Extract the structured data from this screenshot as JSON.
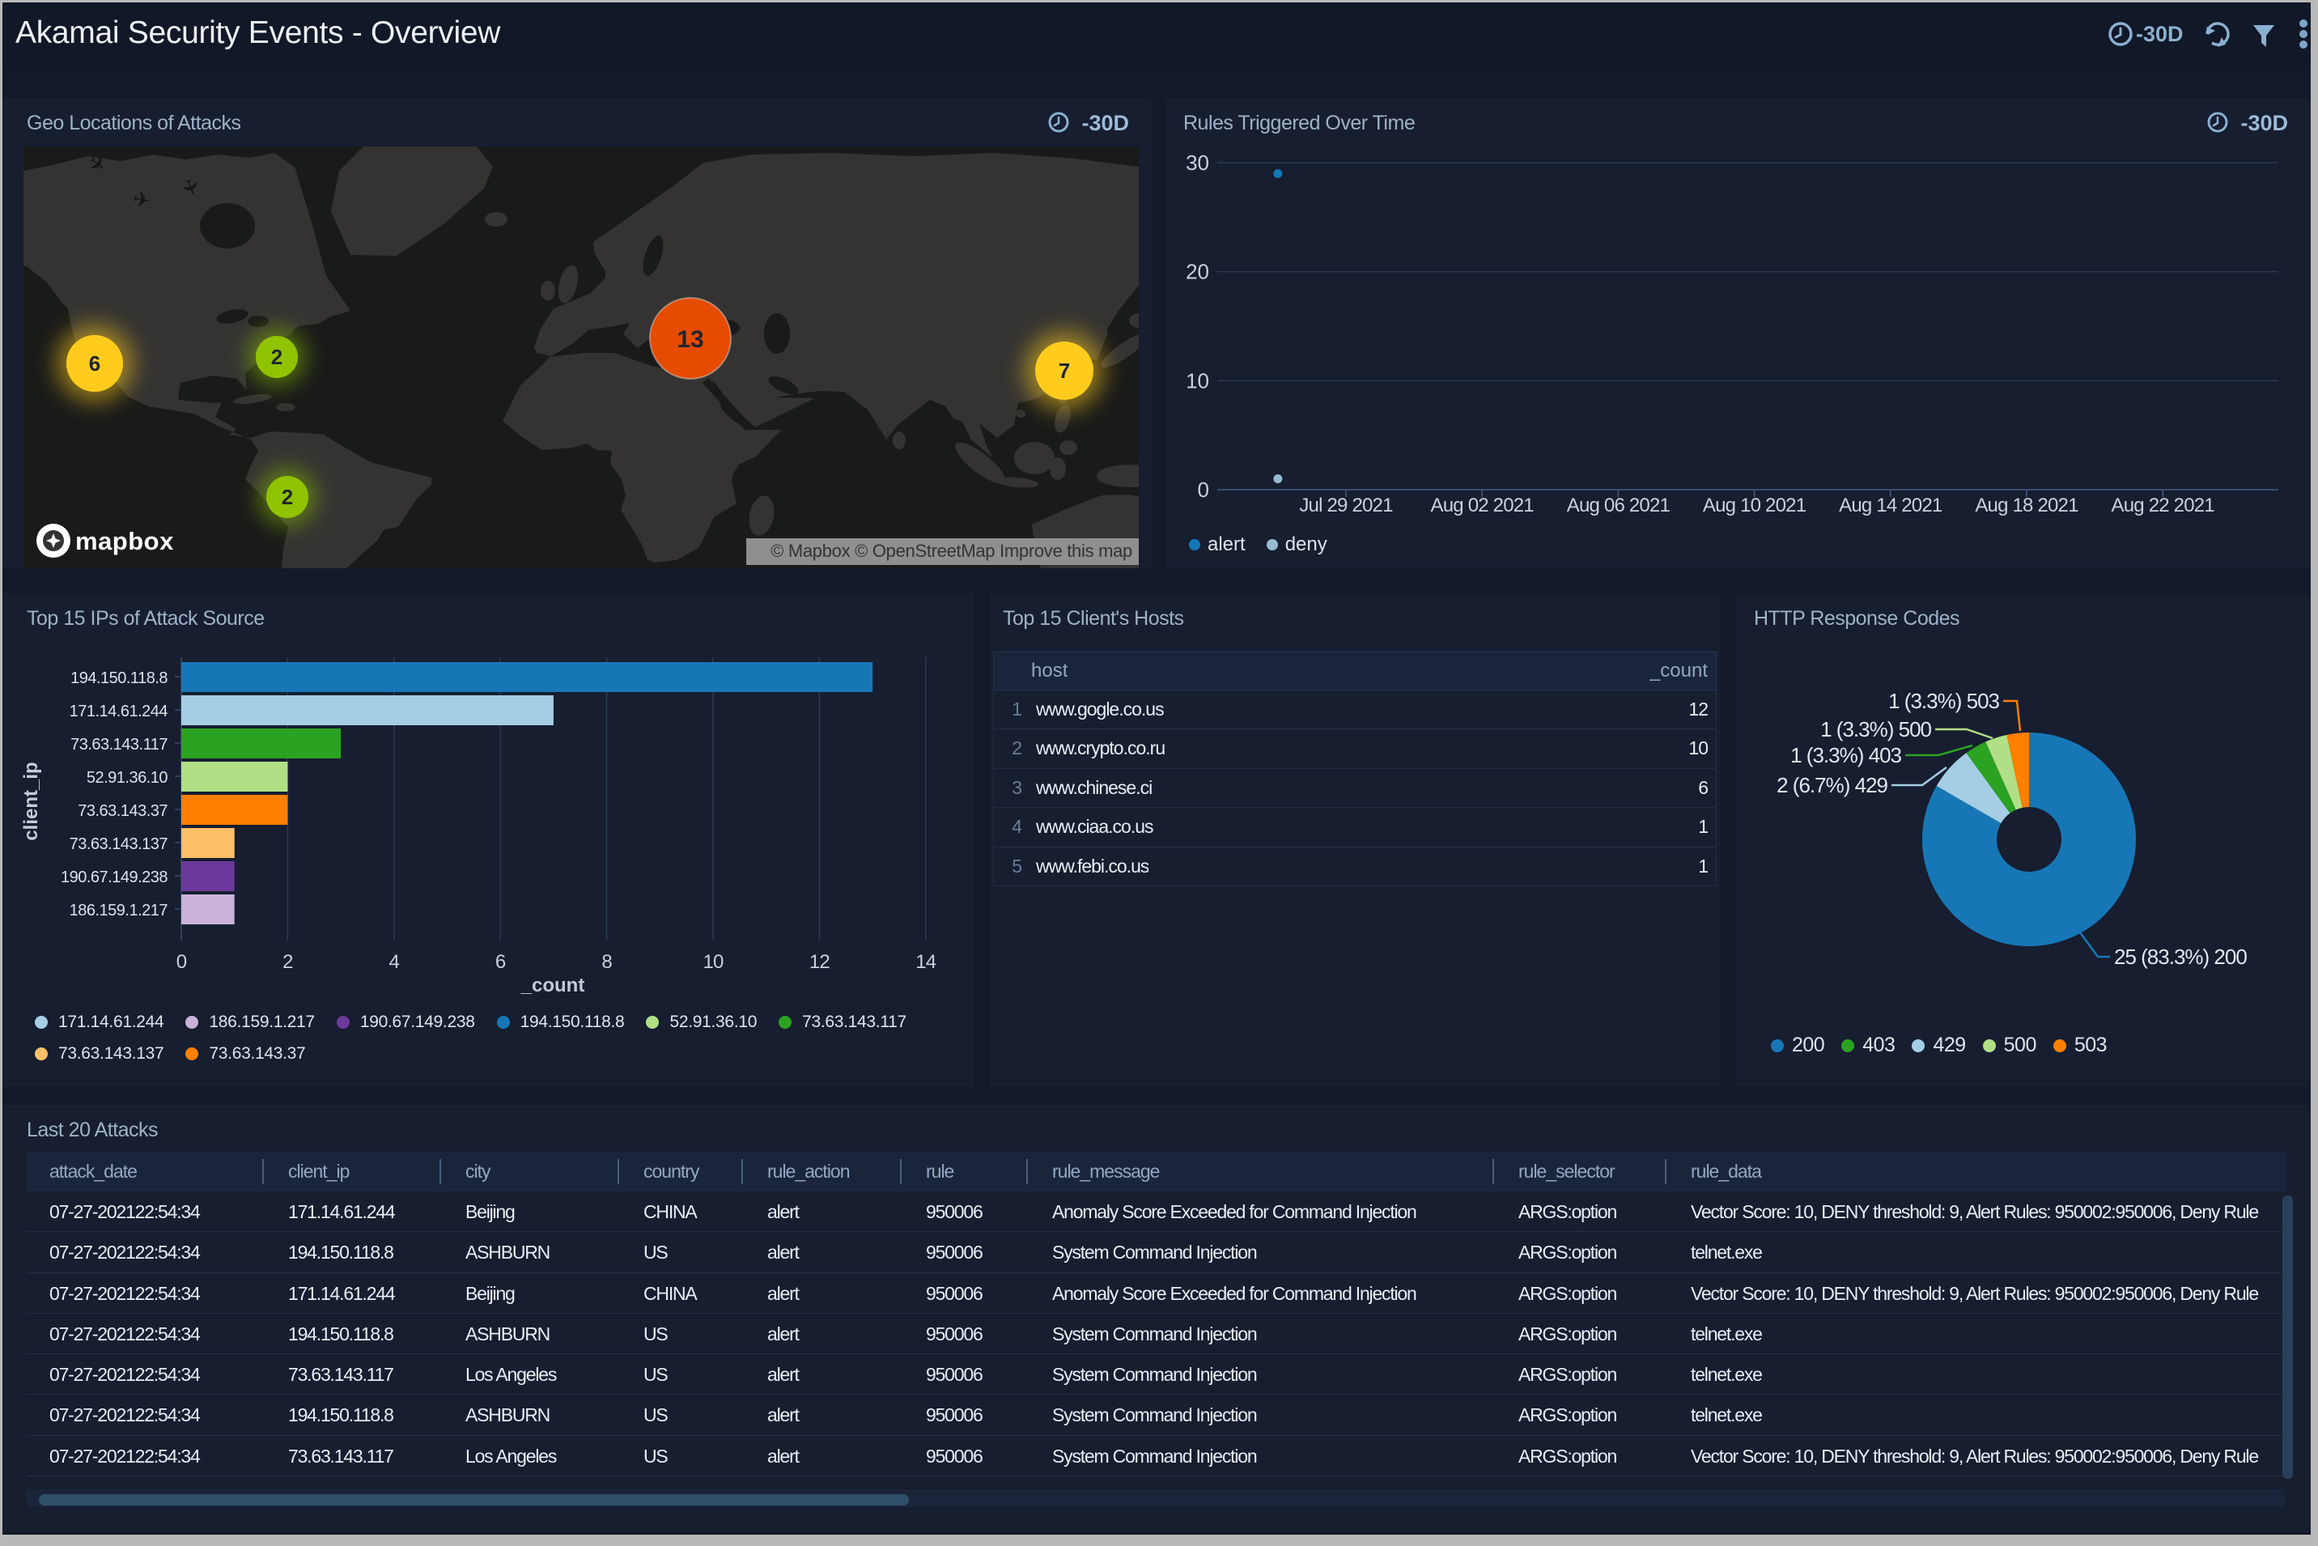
{
  "header": {
    "title": "Akamai Security Events - Overview",
    "time_range": "-30D"
  },
  "accent": {
    "icon_color": "#8bb0d0",
    "panel_bg": "#161e30",
    "header_bg": "#111827",
    "page_bg": "#121a29"
  },
  "panels": {
    "geo": {
      "title": "Geo Locations of Attacks",
      "time_range": "-30D",
      "map": {
        "logo_text": "mapbox",
        "attribution": "© Mapbox © OpenStreetMap Improve this map",
        "markers": [
          {
            "count": 6,
            "color": "#ffcc1e",
            "glow": true,
            "region": "us-west"
          },
          {
            "count": 2,
            "color": "#90c300",
            "glow": true,
            "region": "us-east"
          },
          {
            "count": 13,
            "color": "#e64b00",
            "glow": false,
            "region": "turkey"
          },
          {
            "count": 7,
            "color": "#ffcc1e",
            "glow": true,
            "region": "china-east"
          },
          {
            "count": 2,
            "color": "#90c300",
            "glow": true,
            "region": "colombia"
          }
        ]
      }
    },
    "rules": {
      "title": "Rules Triggered Over Time",
      "time_range": "-30D",
      "chart_data": {
        "type": "scatter",
        "ylim": [
          0,
          30
        ],
        "yticks": [
          0,
          10,
          20,
          30
        ],
        "xticks": [
          "Jul 29 2021",
          "Aug 02 2021",
          "Aug 06 2021",
          "Aug 10 2021",
          "Aug 14 2021",
          "Aug 18 2021",
          "Aug 22 2021"
        ],
        "series": [
          {
            "name": "alert",
            "color": "#1777b6",
            "points": [
              {
                "x": "Jul 27 2021",
                "x_days_from_first_tick": -2,
                "y": 29
              }
            ]
          },
          {
            "name": "deny",
            "color": "#96bbd0",
            "points": [
              {
                "x": "Jul 27 2021",
                "x_days_from_first_tick": -2,
                "y": 1
              }
            ]
          }
        ]
      }
    },
    "top_ips": {
      "title": "Top 15 IPs of Attack Source",
      "chart_data": {
        "type": "bar",
        "orientation": "horizontal",
        "xlabel": "_count",
        "ylabel": "client_ip",
        "xlim": [
          0,
          14
        ],
        "xticks": [
          0,
          2,
          4,
          6,
          8,
          10,
          12,
          14
        ],
        "categories": [
          "194.150.118.8",
          "171.14.61.244",
          "73.63.143.117",
          "52.91.36.10",
          "73.63.143.37",
          "73.63.143.137",
          "190.67.149.238",
          "186.159.1.217"
        ],
        "values": [
          13,
          7,
          3,
          2,
          2,
          1,
          1,
          1
        ],
        "colors": [
          "#1777b6",
          "#a5cee4",
          "#2ba222",
          "#b1df86",
          "#ff7f00",
          "#ffc068",
          "#6b399c",
          "#cab1d7"
        ],
        "legend": [
          {
            "label": "171.14.61.244",
            "color": "#a5cee4"
          },
          {
            "label": "186.159.1.217",
            "color": "#cab1d7"
          },
          {
            "label": "190.67.149.238",
            "color": "#6b399c"
          },
          {
            "label": "194.150.118.8",
            "color": "#1777b6"
          },
          {
            "label": "52.91.36.10",
            "color": "#b1df86"
          },
          {
            "label": "73.63.143.117",
            "color": "#2ba222"
          },
          {
            "label": "73.63.143.137",
            "color": "#ffc068"
          },
          {
            "label": "73.63.143.37",
            "color": "#ff7f00"
          }
        ]
      }
    },
    "hosts": {
      "title": "Top 15 Client's Hosts",
      "table": {
        "columns": [
          "host",
          "_count"
        ],
        "rows": [
          {
            "rank": 1,
            "host": "www.gogle.co.us",
            "count": 12
          },
          {
            "rank": 2,
            "host": "www.crypto.co.ru",
            "count": 10
          },
          {
            "rank": 3,
            "host": "www.chinese.ci",
            "count": 6
          },
          {
            "rank": 4,
            "host": "www.ciaa.co.us",
            "count": 1
          },
          {
            "rank": 5,
            "host": "www.febi.co.us",
            "count": 1
          }
        ]
      }
    },
    "http_codes": {
      "title": "HTTP Response Codes",
      "chart_data": {
        "type": "pie",
        "donut": true,
        "categories": [
          "200",
          "429",
          "403",
          "500",
          "503"
        ],
        "values": [
          25,
          2,
          1,
          1,
          1
        ],
        "percents": [
          83.3,
          6.7,
          3.3,
          3.3,
          3.3
        ],
        "colors": [
          "#1777b6",
          "#a5cee4",
          "#2ba222",
          "#b1df86",
          "#ff7f00"
        ],
        "slice_labels": [
          {
            "text": "25 (83.3%) 200",
            "code": "200"
          },
          {
            "text": "2 (6.7%) 429",
            "code": "429"
          },
          {
            "text": "1 (3.3%) 403",
            "code": "403"
          },
          {
            "text": "1 (3.3%) 500",
            "code": "500"
          },
          {
            "text": "1 (3.3%) 503",
            "code": "503"
          }
        ],
        "legend": [
          {
            "label": "200",
            "color": "#1777b6"
          },
          {
            "label": "403",
            "color": "#2ba222"
          },
          {
            "label": "429",
            "color": "#a5cee4"
          },
          {
            "label": "500",
            "color": "#b1df86"
          },
          {
            "label": "503",
            "color": "#ff7f00"
          }
        ]
      }
    },
    "attacks": {
      "title": "Last 20 Attacks",
      "columns": [
        "attack_date",
        "client_ip",
        "city",
        "country",
        "rule_action",
        "rule",
        "rule_message",
        "rule_selector",
        "rule_data"
      ],
      "rows": [
        [
          "07-27-202122:54:34",
          "171.14.61.244",
          "Beijing",
          "CHINA",
          "alert",
          "950006",
          "Anomaly Score Exceeded for Command Injection",
          "ARGS:option",
          "Vector Score: 10, DENY threshold: 9, Alert Rules: 950002:950006, Deny Rule"
        ],
        [
          "07-27-202122:54:34",
          "194.150.118.8",
          "ASHBURN",
          "US",
          "alert",
          "950006",
          "System Command Injection",
          "ARGS:option",
          "telnet.exe"
        ],
        [
          "07-27-202122:54:34",
          "171.14.61.244",
          "Beijing",
          "CHINA",
          "alert",
          "950006",
          "Anomaly Score Exceeded for Command Injection",
          "ARGS:option",
          "Vector Score: 10, DENY threshold: 9, Alert Rules: 950002:950006, Deny Rule"
        ],
        [
          "07-27-202122:54:34",
          "194.150.118.8",
          "ASHBURN",
          "US",
          "alert",
          "950006",
          "System Command Injection",
          "ARGS:option",
          "telnet.exe"
        ],
        [
          "07-27-202122:54:34",
          "73.63.143.117",
          "Los Angeles",
          "US",
          "alert",
          "950006",
          "System Command Injection",
          "ARGS:option",
          "telnet.exe"
        ],
        [
          "07-27-202122:54:34",
          "194.150.118.8",
          "ASHBURN",
          "US",
          "alert",
          "950006",
          "System Command Injection",
          "ARGS:option",
          "telnet.exe"
        ],
        [
          "07-27-202122:54:34",
          "73.63.143.117",
          "Los Angeles",
          "US",
          "alert",
          "950006",
          "System Command Injection",
          "ARGS:option",
          "Vector Score: 10, DENY threshold: 9, Alert Rules: 950002:950006, Deny Rule"
        ]
      ]
    }
  }
}
